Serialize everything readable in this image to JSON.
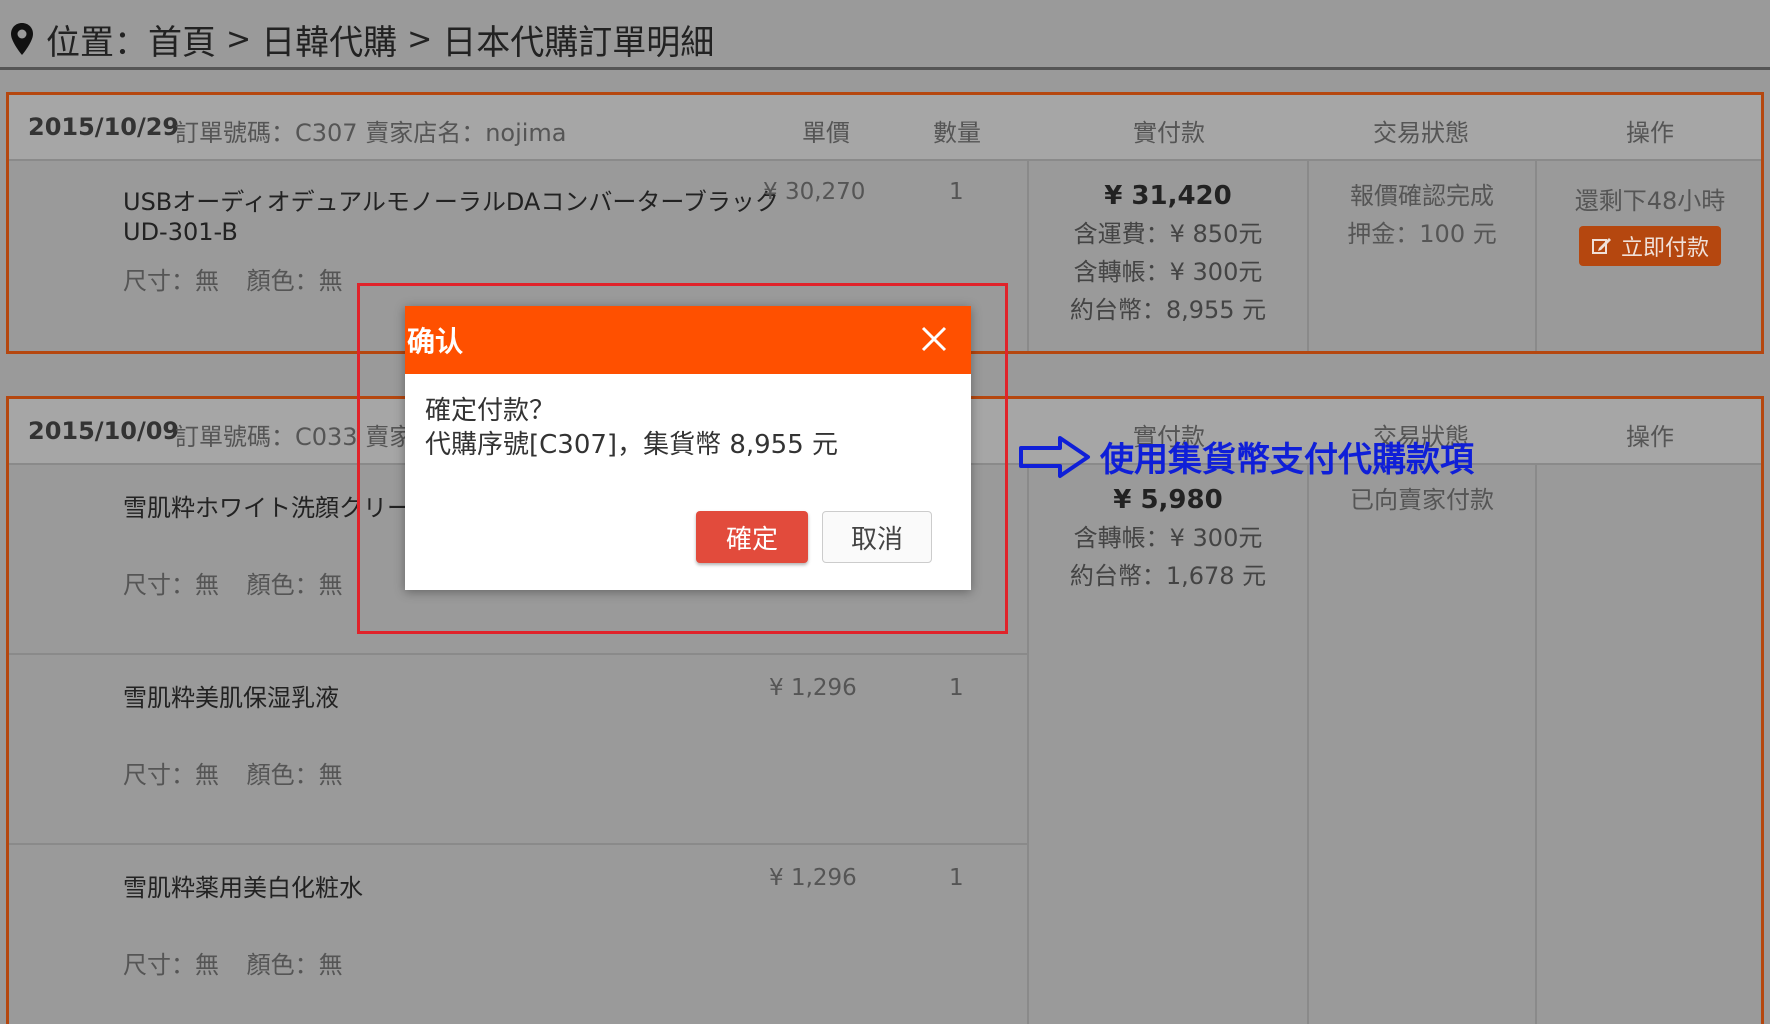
{
  "breadcrumb": {
    "location_label": "位置：首頁",
    "sep": ">",
    "level2": "日韓代購",
    "level3": "日本代購訂單明細"
  },
  "columns": {
    "unit_price": "單價",
    "quantity": "數量",
    "paid": "實付款",
    "status": "交易狀態",
    "action": "操作"
  },
  "order1": {
    "date": "2015/10/29",
    "meta": "訂單號碼：C307 賣家店名：nojima",
    "item": {
      "name_line1": "USBオーディオデュアルモノーラルDAコンバーターブラック",
      "name_line2": "UD-301-B",
      "size": "尺寸：無",
      "color": "顏色：無",
      "price": "¥ 30,270",
      "qty": "1"
    },
    "paid": {
      "total": "¥ 31,420",
      "shipping": "含運費：¥ 850元",
      "transfer": "含轉帳：¥ 300元",
      "twd": "約台幣：8,955 元"
    },
    "status": {
      "line1": "報價確認完成",
      "line2": "押金：100 元"
    },
    "action": {
      "remaining": "還剩下48小時",
      "pay_button": "立即付款"
    }
  },
  "order2": {
    "date": "2015/10/09",
    "meta": "訂單號碼：C033 賣家",
    "items": [
      {
        "name": "雪肌粋ホワイト洗顔クリーム",
        "size": "尺寸：無",
        "color": "顏色：無",
        "price": "",
        "qty": ""
      },
      {
        "name": "雪肌粋美肌保湿乳液",
        "size": "尺寸：無",
        "color": "顏色：無",
        "price": "¥ 1,296",
        "qty": "1"
      },
      {
        "name": "雪肌粋薬用美白化粧水",
        "size": "尺寸：無",
        "color": "顏色：無",
        "price": "¥ 1,296",
        "qty": "1"
      }
    ],
    "paid": {
      "total": "¥ 5,980",
      "transfer": "含轉帳：¥ 300元",
      "twd": "約台幣：1,678 元"
    },
    "status": {
      "line1": "已向賣家付款"
    }
  },
  "dialog": {
    "title": "确认",
    "line1": "確定付款？",
    "line2": "代購序號[C307]，集貨幣 8,955 元",
    "ok": "確定",
    "cancel": "取消"
  },
  "annotation": {
    "text": "使用集貨幣支付代購款項"
  },
  "colors": {
    "accent": "#ff5000",
    "highlight": "#e0232a",
    "annotation": "#0f1fd8",
    "order_border": "#b5470f"
  }
}
